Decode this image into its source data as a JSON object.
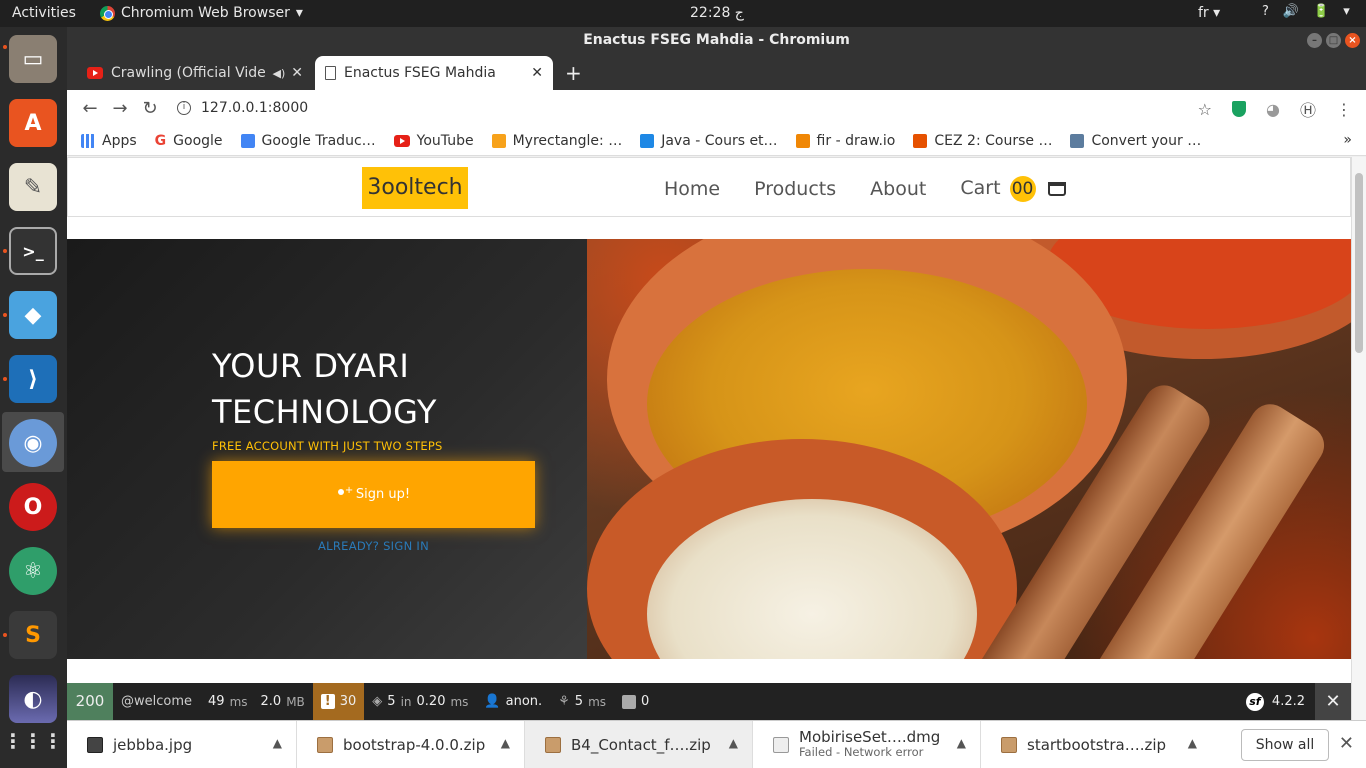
{
  "topbar": {
    "activities": "Activities",
    "app_menu": "Chromium Web Browser",
    "clock": "22:28 ج",
    "lang": "fr",
    "tray": [
      "?",
      "🔊",
      "🔋"
    ]
  },
  "window": {
    "title": "Enactus FSEG Mahdia - Chromium",
    "tabs": [
      {
        "title": "Crawling (Official Vide",
        "active": false
      },
      {
        "title": "Enactus FSEG Mahdia",
        "active": true
      }
    ]
  },
  "toolbar": {
    "url": "127.0.0.1:8000"
  },
  "bookmarks": [
    {
      "label": "Apps",
      "color": "#4285f4"
    },
    {
      "label": "Google",
      "color": "#ea4335"
    },
    {
      "label": "Google Traduc…",
      "color": "#4285f4"
    },
    {
      "label": "YouTube",
      "color": "#e62117"
    },
    {
      "label": "Myrectangle: …",
      "color": "#f7a21b"
    },
    {
      "label": "Java - Cours et…",
      "color": "#1e88e5"
    },
    {
      "label": "fir - draw.io",
      "color": "#f08705"
    },
    {
      "label": "CEZ 2: Course …",
      "color": "#e65100"
    },
    {
      "label": "Convert your …",
      "color": "#5c7c9e"
    }
  ],
  "site": {
    "brand": "3ooltech",
    "nav": {
      "home": "Home",
      "products": "Products",
      "about": "About",
      "cart": "Cart",
      "cart_count": "00"
    },
    "hero": {
      "title_line1": "YOUR DYARI",
      "title_line2": "TECHNOLOGY",
      "subtitle": "FREE ACCOUNT WITH JUST TWO STEPS",
      "signup": "Sign up!",
      "signin": "ALREADY? SIGN IN"
    }
  },
  "debugbar": {
    "status": "200",
    "route": "@welcome",
    "time": "49",
    "time_unit": "ms",
    "memory": "2.0",
    "memory_unit": "MB",
    "warnings": "30",
    "cache_count": "5",
    "cache_in": "in",
    "cache_time": "0.20",
    "cache_unit": "ms",
    "user": "anon.",
    "twig_time": "5",
    "twig_unit": "ms",
    "forms": "0",
    "version": "4.2.2"
  },
  "downloads": {
    "items": [
      {
        "name": "jebbba.jpg",
        "status": ""
      },
      {
        "name": "bootstrap-4.0.0.zip",
        "status": ""
      },
      {
        "name": "B4_Contact_f….zip",
        "status": ""
      },
      {
        "name": "MobiriseSet….dmg",
        "status": "Failed - Network error"
      },
      {
        "name": "startbootstra….zip",
        "status": ""
      }
    ],
    "show_all": "Show all"
  },
  "colors": {
    "accent": "#ffc107",
    "signup": "#ffa500",
    "status_ok": "#4f805d"
  }
}
